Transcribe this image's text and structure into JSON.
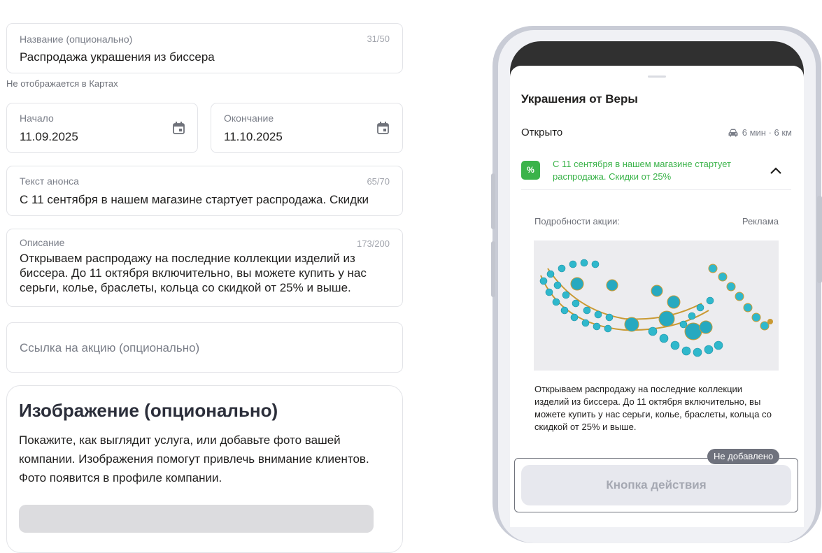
{
  "form": {
    "name_field": {
      "label": "Название (опционально)",
      "counter": "31/50",
      "value": "Распродажа украшения из биссера"
    },
    "name_hint": "Не отображается в Картах",
    "start_field": {
      "label": "Начало",
      "value": "11.09.2025",
      "icon": "calendar-icon"
    },
    "end_field": {
      "label": "Окончание",
      "value": "11.10.2025",
      "icon": "calendar-icon"
    },
    "announce_field": {
      "label": "Текст анонса",
      "counter": "65/70",
      "value": "С 11 сентября в нашем магазине стартует распродажа. Скидки"
    },
    "description_field": {
      "label": "Описание",
      "counter": "173/200",
      "lines": [
        "Открываем распродажу на последние коллекции изделий из",
        "биссера. До 11 октября включительно, вы можете купить у нас",
        "серьги, колье, браслеты, кольца со скидкой от 25% и выше."
      ]
    },
    "link_field": {
      "placeholder": "Ссылка на акцию (опционально)"
    },
    "image_section": {
      "title": "Изображение (опционально)",
      "text": "Покажите, как выглядит услуга, или добавьте фото вашей компании. Изображения помогут привлечь внимание клиентов. Фото появится в профиле компании."
    }
  },
  "preview": {
    "org_name": "Украшения от Веры",
    "status": "Открыто",
    "route": {
      "icon": "car-icon",
      "text": "6 мин · 6 км"
    },
    "promo": {
      "badge": "%",
      "text": "С 11 сентября в нашем магазине стартует распродажа. Скидки от 25%"
    },
    "details_label": "Подробности акции:",
    "ad_label": "Реклама",
    "image_alt": "turquoise-beaded-necklace-photo",
    "description": "Открываем распродажу на последние коллекции изделий из биссера. До 11 октября включительно, вы можете купить у нас серьги, колье, браслеты, кольца со скидкой от 25% и выше.",
    "not_added_badge": "Не добавлено",
    "action_button": "Кнопка действия"
  },
  "colors": {
    "accent_green": "#3bb34a",
    "field_border": "#e3e4e8",
    "turquoise": "#29b3c9"
  }
}
